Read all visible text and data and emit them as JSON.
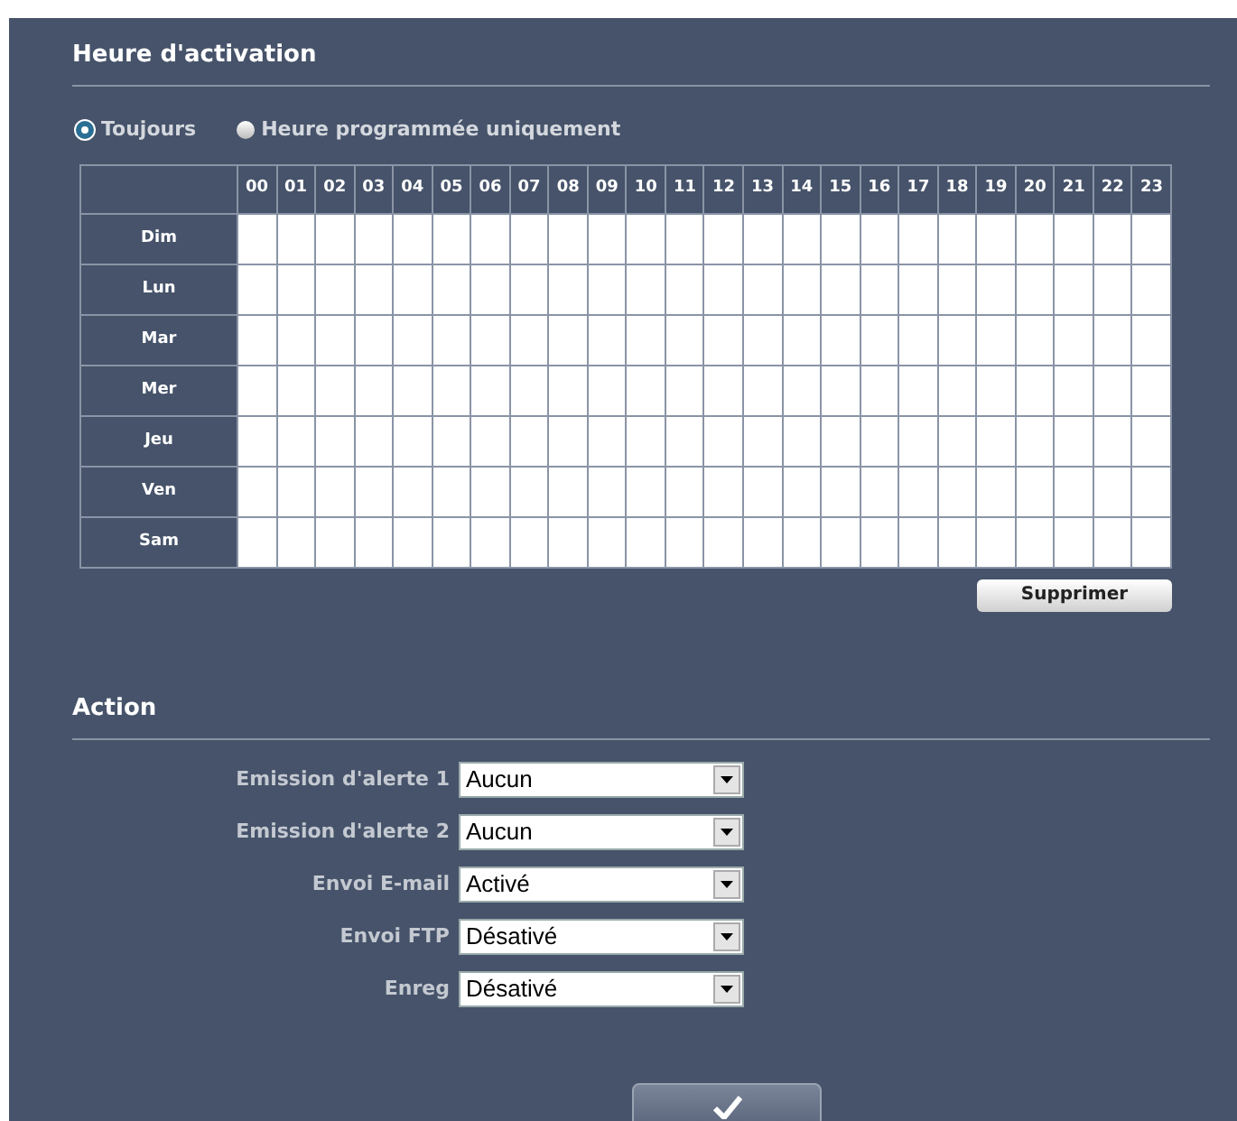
{
  "activation": {
    "title": "Heure d'activation",
    "modes": [
      {
        "label": "Toujours",
        "selected": true
      },
      {
        "label": "Heure programmée uniquement",
        "selected": false
      }
    ],
    "hours": [
      "00",
      "01",
      "02",
      "03",
      "04",
      "05",
      "06",
      "07",
      "08",
      "09",
      "10",
      "11",
      "12",
      "13",
      "14",
      "15",
      "16",
      "17",
      "18",
      "19",
      "20",
      "21",
      "22",
      "23"
    ],
    "days": [
      "Dim",
      "Lun",
      "Mar",
      "Mer",
      "Jeu",
      "Ven",
      "Sam"
    ],
    "delete_button": "Supprimer"
  },
  "action": {
    "title": "Action",
    "fields": [
      {
        "label": "Emission d'alerte 1",
        "value": "Aucun"
      },
      {
        "label": "Emission d'alerte 2",
        "value": "Aucun"
      },
      {
        "label": "Envoi E-mail",
        "value": "Activé"
      },
      {
        "label": "Envoi FTP",
        "value": "Désativé"
      },
      {
        "label": "Enreg",
        "value": "Désativé"
      }
    ]
  }
}
